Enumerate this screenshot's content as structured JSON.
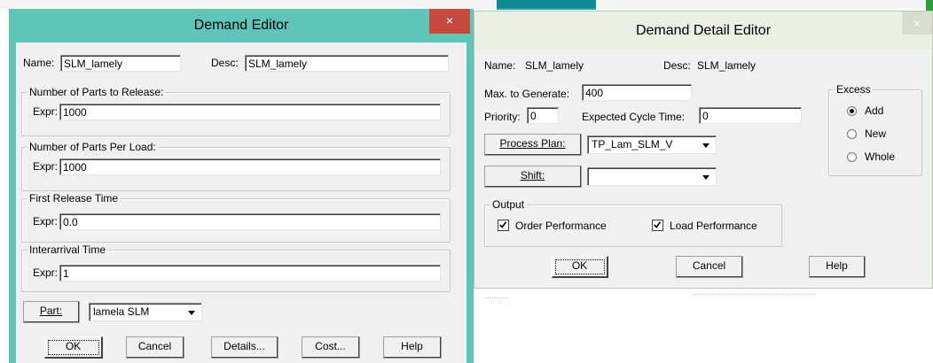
{
  "demand_editor": {
    "title": "Demand Editor",
    "close": "×",
    "name_label": "Name:",
    "name_value": "SLM_lamely",
    "desc_label": "Desc:",
    "desc_value": "SLM_lamely",
    "groups": [
      {
        "title": "Number of Parts to Release:",
        "expr_label": "Expr:",
        "expr_value": "1000"
      },
      {
        "title": "Number of Parts Per Load:",
        "expr_label": "Expr:",
        "expr_value": "1000"
      },
      {
        "title": "First Release Time",
        "expr_label": "Expr:",
        "expr_value": "0.0"
      },
      {
        "title": "Interarrival Time",
        "expr_label": "Expr:",
        "expr_value": "1"
      }
    ],
    "part_button": "Part:",
    "part_value": "lamela SLM",
    "buttons": {
      "ok": "OK",
      "cancel": "Cancel",
      "details": "Details...",
      "cost": "Cost...",
      "help": "Help"
    }
  },
  "detail_editor": {
    "title": "Demand Detail Editor",
    "close": "×",
    "name_label": "Name:",
    "name_value": "SLM_lamely",
    "desc_label": "Desc:",
    "desc_value": "SLM_lamely",
    "max_label": "Max. to Generate:",
    "max_value": "400",
    "priority_label": "Priority:",
    "priority_value": "0",
    "cycle_label": "Expected Cycle Time:",
    "cycle_value": "0",
    "process_plan_button": "Process Plan:",
    "process_plan_value": "TP_Lam_SLM_V",
    "shift_button": "Shift:",
    "shift_value": "",
    "excess": {
      "title": "Excess",
      "options": [
        "Add",
        "New",
        "Whole"
      ],
      "selected": "Add"
    },
    "output": {
      "title": "Output",
      "order_perf": "Order Performance",
      "load_perf": "Load Performance",
      "order_checked": true,
      "load_checked": true
    },
    "buttons": {
      "ok": "OK",
      "cancel": "Cancel",
      "help": "Help"
    }
  },
  "colors": {
    "accent": "#5fc5b8",
    "close_red": "#c7493e",
    "dialog_bg": "#f0f0f0"
  }
}
